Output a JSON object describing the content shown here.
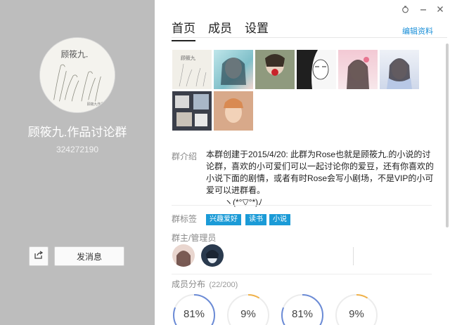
{
  "group": {
    "name": "顾筱九.作品讨论群",
    "id": "324272190"
  },
  "left_actions": {
    "send_message": "发消息"
  },
  "tabs": [
    {
      "label": "首页",
      "active": true
    },
    {
      "label": "成员",
      "active": false
    },
    {
      "label": "设置",
      "active": false
    }
  ],
  "edit_profile": "编辑资料",
  "intro": {
    "label": "群介绍",
    "text": "本群创建于2015/4/20:  此群为Rose也就是顾筱九.的小说的讨论群，喜欢的小可爱们可以一起讨论你的爱豆，还有你喜欢的小说下面的剧情，或者有时Rose会写小剧场，不是VIP的小可爱可以进群看。",
    "emoticon": "ヽ(*°▽°*)ﾉ"
  },
  "tags": {
    "label": "群标签",
    "items": [
      "兴趣爱好",
      "读书",
      "小说"
    ]
  },
  "admins": {
    "label": "群主/管理员"
  },
  "distribution": {
    "label": "成员分布",
    "count": "(22/200)",
    "rings": [
      {
        "value": "81%",
        "fraction": 0.81,
        "color": "#6b8bd6"
      },
      {
        "value": "9%",
        "fraction": 0.09,
        "color": "#f0b24a"
      },
      {
        "value": "81%",
        "fraction": 0.81,
        "color": "#6b8bd6"
      },
      {
        "value": "9%",
        "fraction": 0.09,
        "color": "#f0b24a"
      }
    ]
  },
  "icons": {
    "window_skin": "skin-icon",
    "window_min": "minimize-icon",
    "window_close": "close-icon",
    "share": "share-icon"
  }
}
